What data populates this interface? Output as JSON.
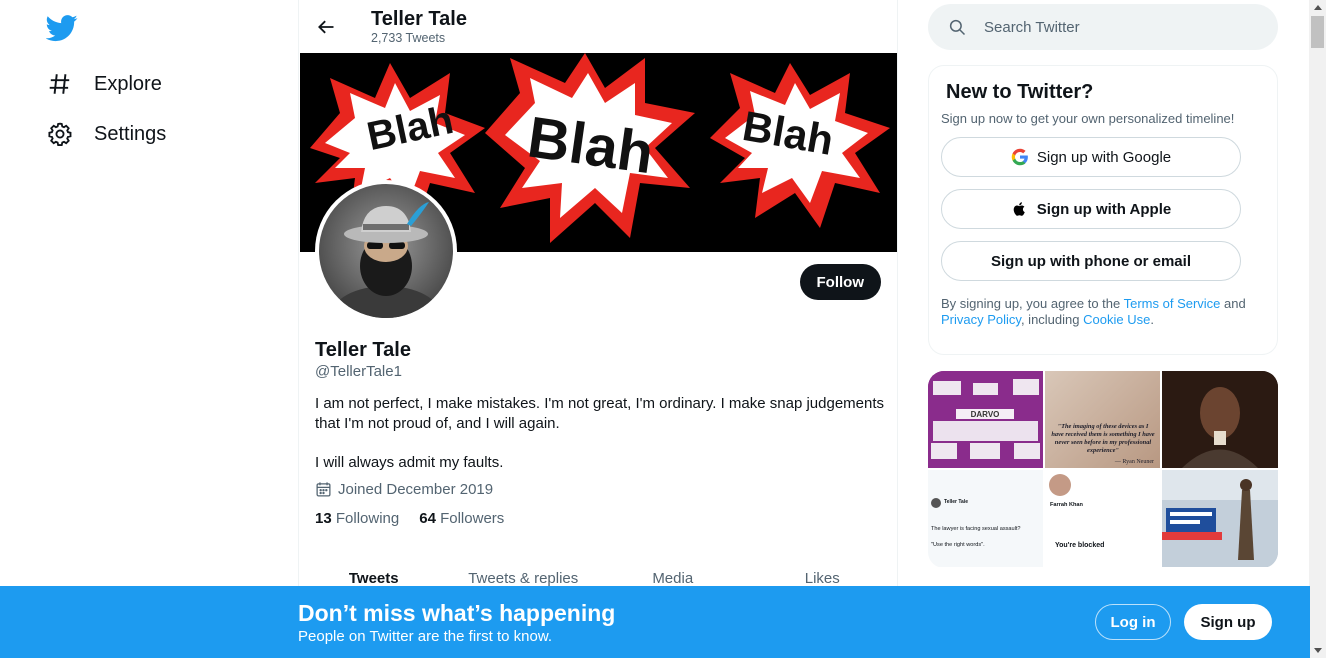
{
  "app": {
    "brand_color": "#1d9bf0"
  },
  "nav": {
    "items": [
      {
        "label": "Explore",
        "icon": "hashtag-icon"
      },
      {
        "label": "Settings",
        "icon": "gear-icon"
      }
    ]
  },
  "header": {
    "title": "Teller Tale",
    "subtitle": "2,733 Tweets"
  },
  "banner": {
    "words": [
      "Blah",
      "Blah",
      "Blah"
    ]
  },
  "profile": {
    "name": "Teller Tale",
    "handle": "@TellerTale1",
    "bio": "I am not perfect, I make mistakes. I'm not great, I'm ordinary. I make snap judgements that I'm not proud of, and I will again.\n\nI will always admit my faults.",
    "joined": "Joined December 2019",
    "following_count": "13",
    "following_label": "Following",
    "followers_count": "64",
    "followers_label": "Followers",
    "follow_label": "Follow"
  },
  "tabs": [
    "Tweets",
    "Tweets & replies",
    "Media",
    "Likes"
  ],
  "search": {
    "placeholder": "Search Twitter"
  },
  "new_to_twitter": {
    "title": "New to Twitter?",
    "subtitle": "Sign up now to get your own personalized timeline!",
    "google": "Sign up with Google",
    "apple": "Sign up with Apple",
    "phone": "Sign up with phone or email",
    "terms_prefix": "By signing up, you agree to the ",
    "terms_link": "Terms of Service",
    "terms_and": " and ",
    "privacy_link": "Privacy Policy",
    "terms_including": ", including ",
    "cookie_link": "Cookie Use",
    "terms_end": "."
  },
  "media": {
    "m1_title": "DARVO",
    "m2_quote": "\"The imaging of these devices as I have received them is something I have never seen before in my professional experience\"",
    "m2_cite": "— Ryan Neuner",
    "m4_name": "Teller Tale",
    "m4_text1": "The lawyer is facing sexual assault?",
    "m4_text2": "\"Use the right words\".",
    "m5_name": "Farrah Khan",
    "m5_blocked": "You're blocked"
  },
  "bottom_bar": {
    "title": "Don’t miss what’s happening",
    "subtitle": "People on Twitter are the first to know.",
    "login": "Log in",
    "signup": "Sign up"
  }
}
